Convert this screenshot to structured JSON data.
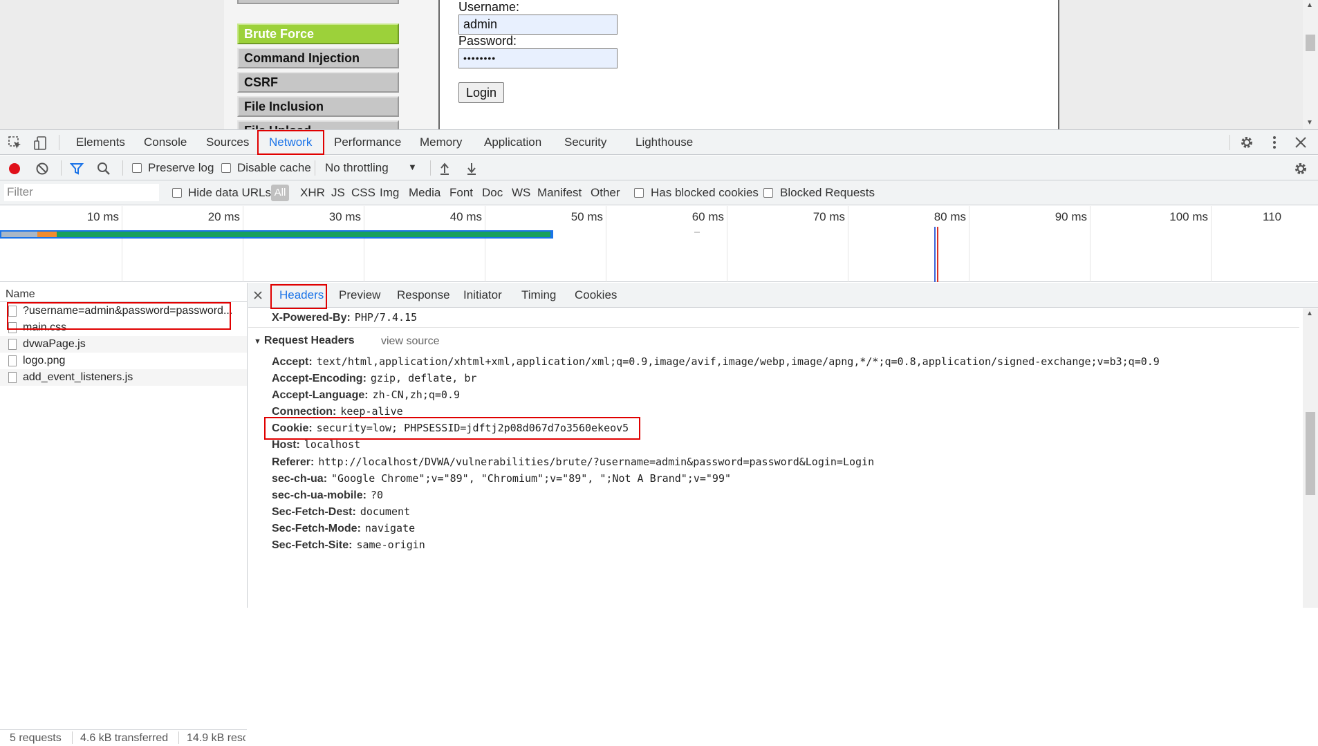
{
  "page": {
    "menu": [
      "Brute Force",
      "Command Injection",
      "CSRF",
      "File Inclusion",
      "File Upload"
    ],
    "active_menu": "Brute Force",
    "form": {
      "username_label": "Username:",
      "username_value": "admin",
      "password_label": "Password:",
      "password_value": "••••••••",
      "login_label": "Login"
    }
  },
  "devtools": {
    "tabs": [
      "Elements",
      "Console",
      "Sources",
      "Network",
      "Performance",
      "Memory",
      "Application",
      "Security",
      "Lighthouse"
    ],
    "active_tab": "Network",
    "toolbar": {
      "preserve_log": "Preserve log",
      "disable_cache": "Disable cache",
      "throttling": "No throttling"
    },
    "filterbar": {
      "filter_placeholder": "Filter",
      "hide_data_urls": "Hide data URLs",
      "types": [
        "All",
        "XHR",
        "JS",
        "CSS",
        "Img",
        "Media",
        "Font",
        "Doc",
        "WS",
        "Manifest",
        "Other"
      ],
      "has_blocked_cookies": "Has blocked cookies",
      "blocked_requests": "Blocked Requests"
    },
    "timeline_ticks": [
      "10 ms",
      "20 ms",
      "30 ms",
      "40 ms",
      "50 ms",
      "60 ms",
      "70 ms",
      "80 ms",
      "90 ms",
      "100 ms",
      "110"
    ],
    "request_list": {
      "header": "Name",
      "rows": [
        "?username=admin&password=password...",
        "main.css",
        "dvwaPage.js",
        "logo.png",
        "add_event_listeners.js"
      ]
    },
    "status": {
      "requests": "5 requests",
      "transferred": "4.6 kB transferred",
      "resources": "14.9 kB resc"
    },
    "detail_tabs": [
      "Headers",
      "Preview",
      "Response",
      "Initiator",
      "Timing",
      "Cookies"
    ],
    "active_detail_tab": "Headers",
    "powered_by": {
      "key": "X-Powered-By:",
      "value": "PHP/7.4.15"
    },
    "request_headers_title": "Request Headers",
    "view_source": "view source",
    "request_headers": [
      {
        "key": "Accept:",
        "value": "text/html,application/xhtml+xml,application/xml;q=0.9,image/avif,image/webp,image/apng,*/*;q=0.8,application/signed-exchange;v=b3;q=0.9"
      },
      {
        "key": "Accept-Encoding:",
        "value": "gzip, deflate, br"
      },
      {
        "key": "Accept-Language:",
        "value": "zh-CN,zh;q=0.9"
      },
      {
        "key": "Connection:",
        "value": "keep-alive"
      },
      {
        "key": "Cookie:",
        "value": "security=low; PHPSESSID=jdftj2p08d067d7o3560ekeov5"
      },
      {
        "key": "Host:",
        "value": "localhost"
      },
      {
        "key": "Referer:",
        "value": "http://localhost/DVWA/vulnerabilities/brute/?username=admin&password=password&Login=Login"
      },
      {
        "key": "sec-ch-ua:",
        "value": "\"Google Chrome\";v=\"89\", \"Chromium\";v=\"89\", \";Not A Brand\";v=\"99\""
      },
      {
        "key": "sec-ch-ua-mobile:",
        "value": "?0"
      },
      {
        "key": "Sec-Fetch-Dest:",
        "value": "document"
      },
      {
        "key": "Sec-Fetch-Mode:",
        "value": "navigate"
      },
      {
        "key": "Sec-Fetch-Site:",
        "value": "same-origin"
      }
    ],
    "colors": {
      "highlight_box": "#e00000",
      "active_menu": "#9cd13a",
      "record": "#e0101a"
    }
  }
}
